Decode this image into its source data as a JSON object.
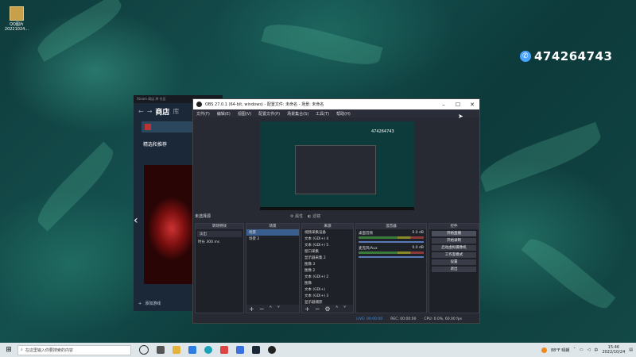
{
  "desktop": {
    "icon_label_1": "QQ图片",
    "icon_label_2": "20221024...",
    "qq_number": "474264743"
  },
  "store": {
    "topbar": "Steam 商店 库 社区",
    "title": "商店",
    "subtab": "库",
    "feature_label": "精选和推荐",
    "add_label": "添加游戏"
  },
  "obs": {
    "title": "OBS 27.0.1 (64-bit, windows) - 配置文件: 未命名 - 场景: 未命名",
    "menu": [
      "文件(F)",
      "编辑(E)",
      "视图(V)",
      "配置文件(P)",
      "场景集合(S)",
      "工具(T)",
      "帮助(H)"
    ],
    "preview_badge": "474264743",
    "no_source": "未选择源",
    "prop_label": "属性",
    "filter_label": "滤镜",
    "transitions": {
      "header": "转场特效",
      "type": "淡出",
      "duration_label": "时长",
      "duration_value": "300 ms"
    },
    "scenes": {
      "header": "场景",
      "items": [
        "场景",
        "场景 2"
      ]
    },
    "sources": {
      "header": "来源",
      "items": [
        "视频采集设备",
        "文本 (GDI+) 4",
        "文本 (GDI+) 5",
        "窗口采集",
        "显示器采集 2",
        "图像 3",
        "图像 2",
        "文本 (GDI+) 2",
        "图像",
        "文本 (GDI+)",
        "文本 (GDI+) 3",
        "显示器捕获"
      ]
    },
    "mixer": {
      "header": "混音器",
      "channels": [
        {
          "name": "桌面音频",
          "value": "0.0 dB"
        },
        {
          "name": "麦克风/Aux",
          "value": "0.0 dB"
        }
      ]
    },
    "controls": {
      "header": "控件",
      "buttons": [
        "开始直播",
        "开始录制",
        "启动虚拟摄像机",
        "工作室模式",
        "设置",
        "退出"
      ]
    },
    "status": {
      "live": "LIVE: 00:00:00",
      "rec": "REC: 00:00:00",
      "cpu": "CPU: 0.0%, 60.00 fps"
    }
  },
  "taskbar": {
    "search_placeholder": "在这里输入你要搜索的内容",
    "weather": "88°F 晴朗",
    "time": "15:46",
    "date": "2022/10/24"
  }
}
